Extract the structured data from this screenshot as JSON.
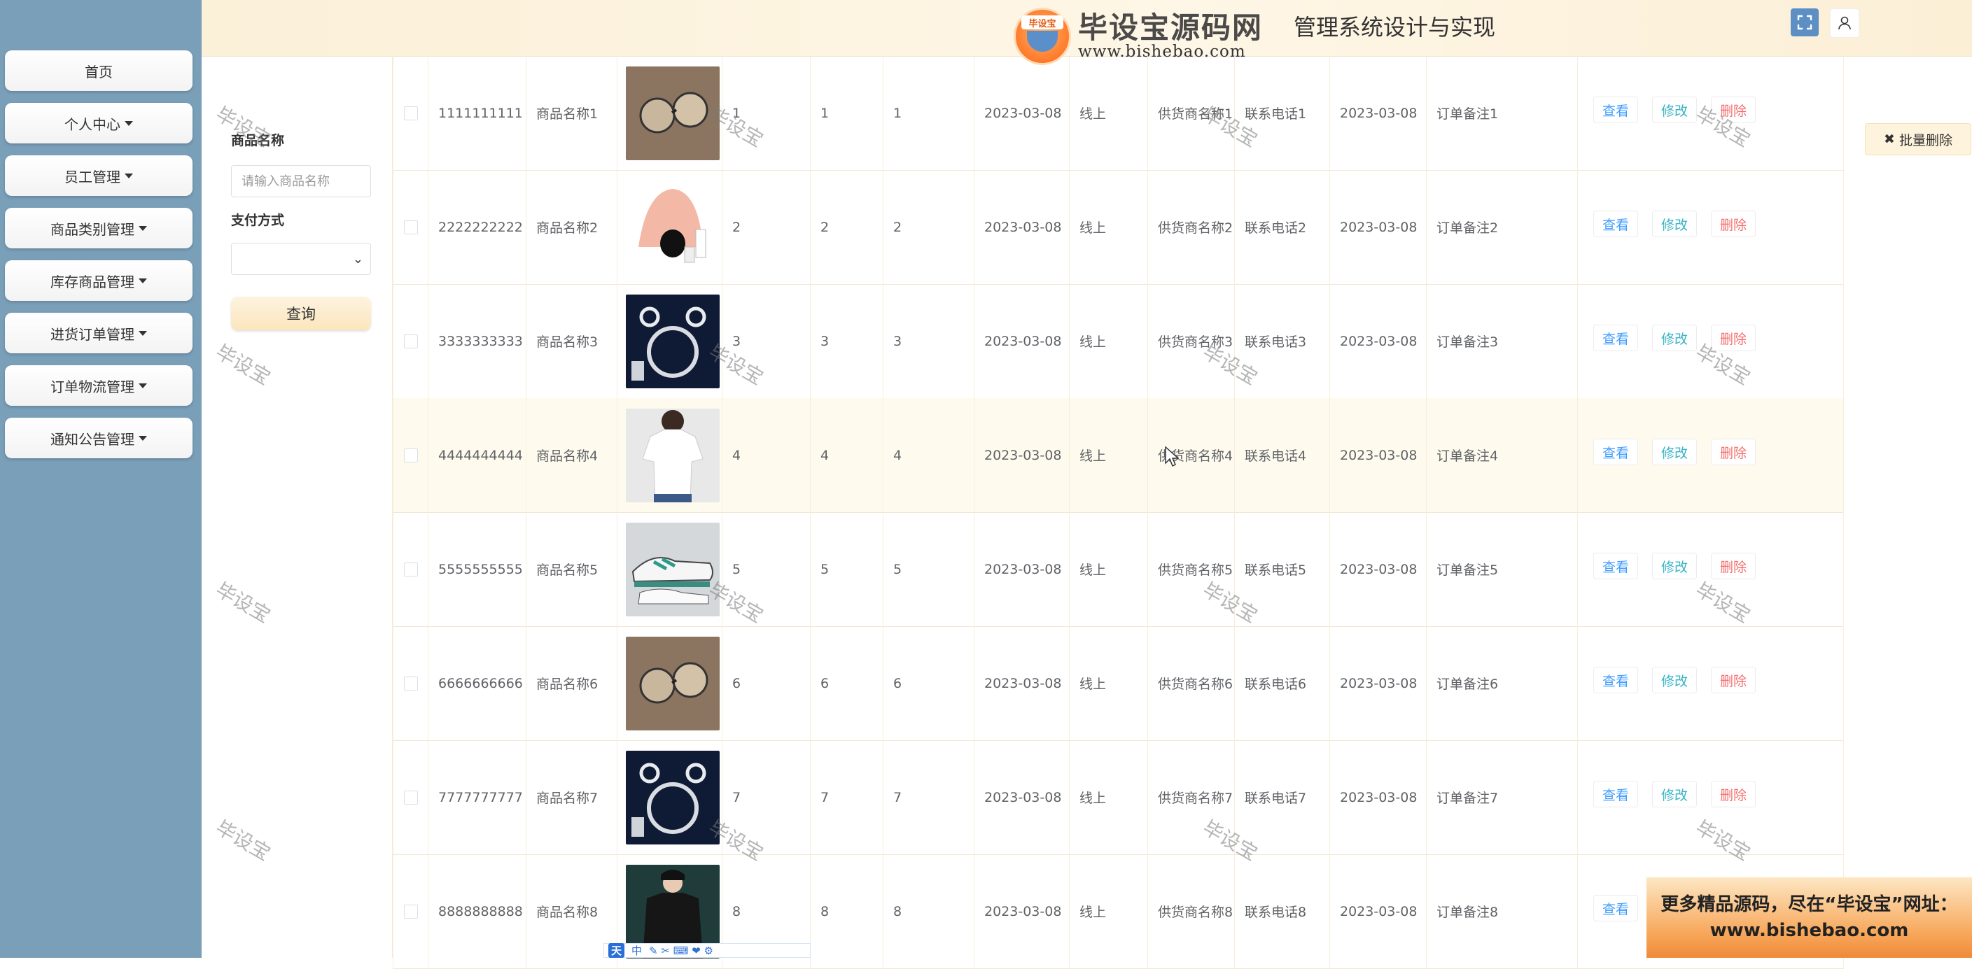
{
  "sidebar": {
    "items": [
      {
        "label": "首页",
        "has_caret": false
      },
      {
        "label": "个人中心",
        "has_caret": true
      },
      {
        "label": "员工管理",
        "has_caret": true
      },
      {
        "label": "商品类别管理",
        "has_caret": true
      },
      {
        "label": "库存商品管理",
        "has_caret": true
      },
      {
        "label": "进货订单管理",
        "has_caret": true
      },
      {
        "label": "订单物流管理",
        "has_caret": true
      },
      {
        "label": "通知公告管理",
        "has_caret": true
      }
    ]
  },
  "header": {
    "title": "管理系统设计与实现",
    "logo_text": "毕设宝源码网",
    "logo_tag": "毕设宝",
    "logo_url": "www.bishebao.com",
    "icons": [
      "fullscreen-icon",
      "user-icon"
    ]
  },
  "search": {
    "name_label": "商品名称",
    "name_placeholder": "请输入商品名称",
    "pay_label": "支付方式",
    "pay_value": "",
    "query_label": "查询"
  },
  "actions": {
    "batch_delete": "批量删除",
    "view": "查看",
    "edit": "修改",
    "delete": "删除"
  },
  "table": {
    "rows": [
      {
        "code": "1111111111",
        "name": "商品名称1",
        "image": "sunglasses",
        "c1": "1",
        "c2": "1",
        "c3": "1",
        "date": "2023-03-08",
        "pay": "线上",
        "supplier": "供货商名称1",
        "phone": "联系电话1",
        "date2": "2023-03-08",
        "note": "订单备注1"
      },
      {
        "code": "2222222222",
        "name": "商品名称2",
        "image": "cosmetics",
        "c1": "2",
        "c2": "2",
        "c3": "2",
        "date": "2023-03-08",
        "pay": "线上",
        "supplier": "供货商名称2",
        "phone": "联系电话2",
        "date2": "2023-03-08",
        "note": "订单备注2"
      },
      {
        "code": "3333333333",
        "name": "商品名称3",
        "image": "jewelry",
        "c1": "3",
        "c2": "3",
        "c3": "3",
        "date": "2023-03-08",
        "pay": "线上",
        "supplier": "供货商名称3",
        "phone": "联系电话3",
        "date2": "2023-03-08",
        "note": "订单备注3"
      },
      {
        "code": "4444444444",
        "name": "商品名称4",
        "image": "tshirt",
        "c1": "4",
        "c2": "4",
        "c3": "4",
        "date": "2023-03-08",
        "pay": "线上",
        "supplier": "供货商名称4",
        "phone": "联系电话4",
        "date2": "2023-03-08",
        "note": "订单备注4"
      },
      {
        "code": "5555555555",
        "name": "商品名称5",
        "image": "sneakers",
        "c1": "5",
        "c2": "5",
        "c3": "5",
        "date": "2023-03-08",
        "pay": "线上",
        "supplier": "供货商名称5",
        "phone": "联系电话5",
        "date2": "2023-03-08",
        "note": "订单备注5"
      },
      {
        "code": "6666666666",
        "name": "商品名称6",
        "image": "sunglasses",
        "c1": "6",
        "c2": "6",
        "c3": "6",
        "date": "2023-03-08",
        "pay": "线上",
        "supplier": "供货商名称6",
        "phone": "联系电话6",
        "date2": "2023-03-08",
        "note": "订单备注6"
      },
      {
        "code": "7777777777",
        "name": "商品名称7",
        "image": "jewelry",
        "c1": "7",
        "c2": "7",
        "c3": "7",
        "date": "2023-03-08",
        "pay": "线上",
        "supplier": "供货商名称7",
        "phone": "联系电话7",
        "date2": "2023-03-08",
        "note": "订单备注7"
      },
      {
        "code": "8888888888",
        "name": "商品名称8",
        "image": "jacket",
        "c1": "8",
        "c2": "8",
        "c3": "8",
        "date": "2023-03-08",
        "pay": "线上",
        "supplier": "供货商名称8",
        "phone": "联系电话8",
        "date2": "2023-03-08",
        "note": "订单备注8"
      }
    ],
    "highlight_row": 3
  },
  "watermark": "毕设宝",
  "promo": {
    "line1": "更多精品源码，尽在“毕设宝”网址：",
    "line2": "www.bishebao.com"
  },
  "ime_toolbar": {
    "label1": "天",
    "label2": "中"
  },
  "colors": {
    "sidebar_bg": "#7a9fb9",
    "view": "#409eff",
    "edit": "#3ab4c5",
    "delete": "#f56c6c",
    "highlight": "#fefbee"
  }
}
